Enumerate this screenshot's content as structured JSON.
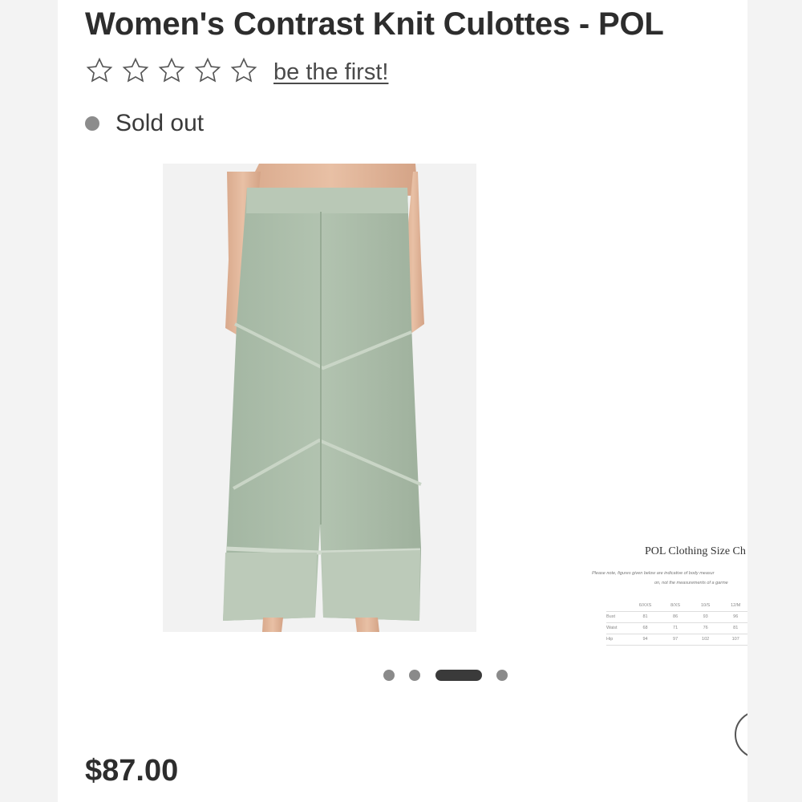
{
  "product": {
    "title": "Women's Contrast Knit Culottes - POL",
    "rating": {
      "stars": 0,
      "max": 5,
      "review_link_label": "be the first!"
    },
    "availability": {
      "label": "Sold out",
      "dot_color": "#8c8c8c"
    },
    "price": "$87.00"
  },
  "gallery": {
    "slides": [
      {
        "image": "product-photo-back-view",
        "alt": "Green culottes back view"
      },
      {
        "image": "size-chart"
      }
    ],
    "current_slide": 3,
    "total_slides": 4,
    "size_chart": {
      "title": "POL Clothing Size Ch",
      "note_line1": "Please note, figures given below are indicative of body measur",
      "note_line2": "on, not the measurements of a garme",
      "headers": [
        "6/XXS",
        "8/XS",
        "10/S",
        "12/M"
      ],
      "rows": [
        {
          "label": "Bust",
          "values": [
            "81",
            "86",
            "93",
            "96"
          ]
        },
        {
          "label": "Waist",
          "values": [
            "68",
            "71",
            "76",
            "81"
          ]
        },
        {
          "label": "Hip",
          "values": [
            "94",
            "97",
            "102",
            "107"
          ]
        }
      ]
    }
  },
  "colors": {
    "text": "#2d2d2d",
    "active_dot": "#3a3a3a",
    "inactive_dot": "#8a8a8a",
    "garment": "#a9bba8"
  },
  "icons": {
    "star": "star-outline-icon",
    "next": "chevron-right-icon"
  }
}
